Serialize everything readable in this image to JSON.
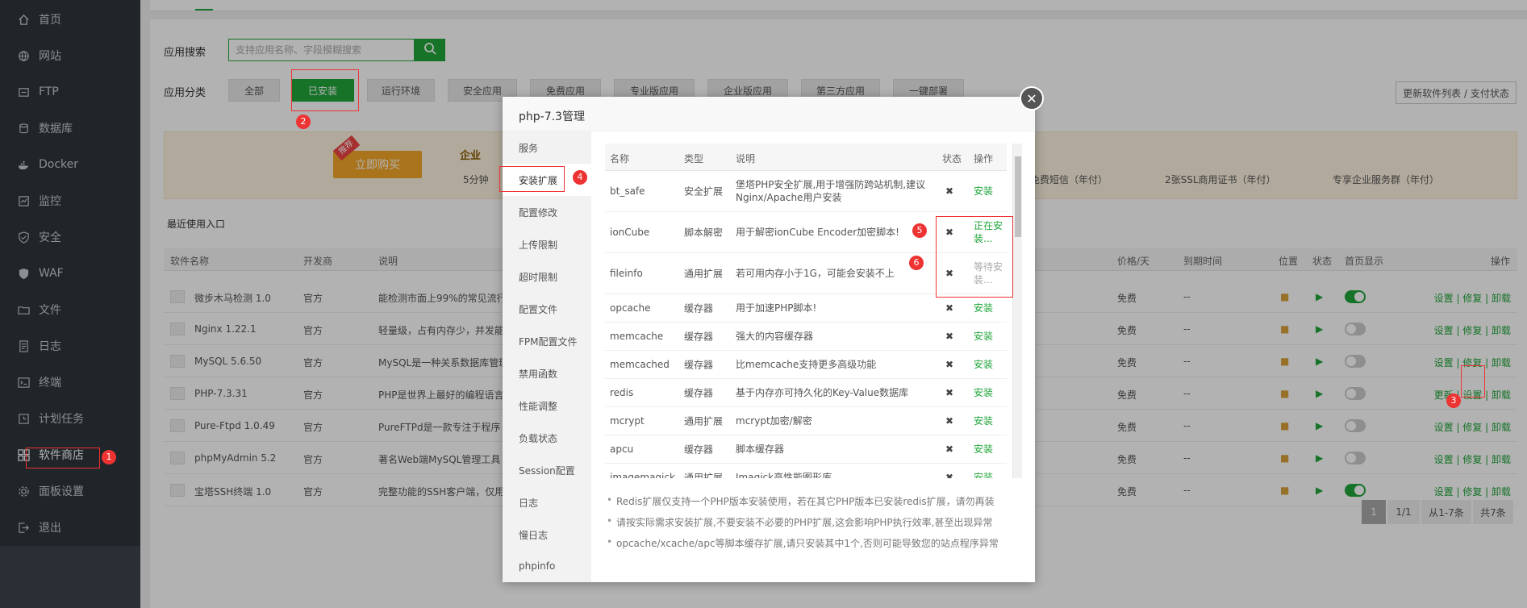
{
  "sidebar": {
    "items": [
      {
        "label": "首页",
        "icon": "home-icon"
      },
      {
        "label": "网站",
        "icon": "globe-icon"
      },
      {
        "label": "FTP",
        "icon": "ftp-icon"
      },
      {
        "label": "数据库",
        "icon": "database-icon"
      },
      {
        "label": "Docker",
        "icon": "docker-icon"
      },
      {
        "label": "监控",
        "icon": "monitor-icon"
      },
      {
        "label": "安全",
        "icon": "shield-icon"
      },
      {
        "label": "WAF",
        "icon": "waf-icon"
      },
      {
        "label": "文件",
        "icon": "folder-icon"
      },
      {
        "label": "日志",
        "icon": "log-icon"
      },
      {
        "label": "终端",
        "icon": "terminal-icon"
      },
      {
        "label": "计划任务",
        "icon": "clock-icon"
      },
      {
        "label": "软件商店",
        "icon": "apps-icon"
      },
      {
        "label": "面板设置",
        "icon": "gear-icon"
      },
      {
        "label": "退出",
        "icon": "logout-icon"
      }
    ]
  },
  "search": {
    "label": "应用搜索",
    "placeholder": "支持应用名称、字段模糊搜索"
  },
  "categories": {
    "label": "应用分类",
    "items": [
      "全部",
      "已安装",
      "运行环境",
      "安全应用",
      "免费应用",
      "专业版应用",
      "企业版应用",
      "第三方应用",
      "一键部署"
    ]
  },
  "update_button": "更新软件列表 / 支付状态",
  "banner": {
    "badge": "推荐",
    "buy": "立即购买",
    "title": "企业",
    "features": [
      "5分钟",
      "免费短信（年付）",
      "2张SSL商用证书（年付）",
      "专享企业服务群（年付）"
    ]
  },
  "recent_label": "最近使用入口",
  "table": {
    "headers": [
      "软件名称",
      "开发商",
      "说明",
      "价格/天",
      "到期时间",
      "位置",
      "状态",
      "首页显示",
      "操作"
    ],
    "rows": [
      {
        "name": "微步木马检测 1.0",
        "vendor": "官方",
        "desc": "能检测市面上99%的常见流行",
        "price": "免费",
        "expire": "--",
        "home": true,
        "ops": "设置 | 修复 | 卸载"
      },
      {
        "name": "Nginx 1.22.1",
        "vendor": "官方",
        "desc": "轻量级，占有内存少，并发能",
        "price": "免费",
        "expire": "--",
        "home": false,
        "ops": "设置 | 修复 | 卸载"
      },
      {
        "name": "MySQL 5.6.50",
        "vendor": "官方",
        "desc": "MySQL是一种关系数据库管理",
        "price": "免费",
        "expire": "--",
        "home": false,
        "ops": "设置 | 修复 | 卸载"
      },
      {
        "name": "PHP-7.3.31",
        "vendor": "官方",
        "desc": "PHP是世界上最好的编程语言",
        "price": "免费",
        "expire": "--",
        "home": false,
        "ops": "更新 | 设置 | 卸载"
      },
      {
        "name": "Pure-Ftpd 1.0.49",
        "vendor": "官方",
        "desc": "PureFTPd是一款专注于程序",
        "price": "免费",
        "expire": "--",
        "home": false,
        "ops": "设置 | 修复 | 卸载"
      },
      {
        "name": "phpMyAdmin 5.2",
        "vendor": "官方",
        "desc": "著名Web端MySQL管理工具",
        "price": "免费",
        "expire": "--",
        "home": false,
        "ops": "设置 | 修复 | 卸载"
      },
      {
        "name": "宝塔SSH终端 1.0",
        "vendor": "官方",
        "desc": "完整功能的SSH客户端，仅用",
        "price": "免费",
        "expire": "--",
        "home": true,
        "ops": "设置 | 修复 | 卸载"
      }
    ]
  },
  "pager": {
    "current": "1",
    "pages": "1/1",
    "range": "从1-7条",
    "total": "共7条"
  },
  "modal": {
    "title": "php-7.3管理",
    "menu": [
      "服务",
      "安装扩展",
      "配置修改",
      "上传限制",
      "超时限制",
      "配置文件",
      "FPM配置文件",
      "禁用函数",
      "性能调整",
      "负载状态",
      "Session配置",
      "日志",
      "慢日志",
      "phpinfo"
    ],
    "headers": [
      "名称",
      "类型",
      "说明",
      "状态",
      "操作"
    ],
    "rows": [
      {
        "name": "bt_safe",
        "type": "安全扩展",
        "desc": "堡塔PHP安全扩展,用于增强防跨站机制,建议Nginx/Apache用户安装",
        "status": "✖",
        "op": "安装"
      },
      {
        "name": "ionCube",
        "type": "脚本解密",
        "desc": "用于解密ionCube Encoder加密脚本!",
        "status": "✖",
        "op": "正在安装..."
      },
      {
        "name": "fileinfo",
        "type": "通用扩展",
        "desc": "若可用内存小于1G，可能会安装不上",
        "status": "✖",
        "op": "等待安装..."
      },
      {
        "name": "opcache",
        "type": "缓存器",
        "desc": "用于加速PHP脚本!",
        "status": "✖",
        "op": "安装"
      },
      {
        "name": "memcache",
        "type": "缓存器",
        "desc": "强大的内容缓存器",
        "status": "✖",
        "op": "安装"
      },
      {
        "name": "memcached",
        "type": "缓存器",
        "desc": "比memcache支持更多高级功能",
        "status": "✖",
        "op": "安装"
      },
      {
        "name": "redis",
        "type": "缓存器",
        "desc": "基于内存亦可持久化的Key-Value数据库",
        "status": "✖",
        "op": "安装"
      },
      {
        "name": "mcrypt",
        "type": "通用扩展",
        "desc": "mcrypt加密/解密",
        "status": "✖",
        "op": "安装"
      },
      {
        "name": "apcu",
        "type": "缓存器",
        "desc": "脚本缓存器",
        "status": "✖",
        "op": "安装"
      },
      {
        "name": "imagemagick",
        "type": "通用扩展",
        "desc": "Imagick高性能图形库",
        "status": "✖",
        "op": "安装"
      }
    ],
    "notes": [
      "Redis扩展仅支持一个PHP版本安装使用，若在其它PHP版本已安装redis扩展，请勿再装",
      "请按实际需求安装扩展,不要安装不必要的PHP扩展,这会影响PHP执行效率,甚至出现异常",
      "opcache/xcache/apc等脚本缓存扩展,请只安装其中1个,否则可能导致您的站点程序异常"
    ]
  },
  "annotations": [
    "1",
    "2",
    "3",
    "4",
    "5",
    "6"
  ],
  "colors": {
    "accent": "#20a53a",
    "sidebar": "#2f363d",
    "marker": "#e33333"
  }
}
